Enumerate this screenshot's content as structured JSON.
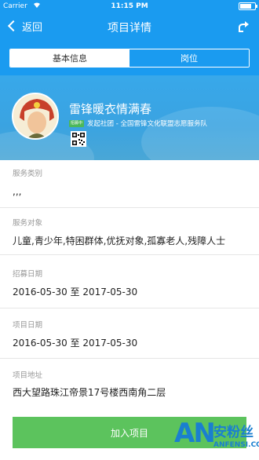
{
  "status_bar": {
    "carrier": "Carrier",
    "time": "11:15 PM"
  },
  "nav": {
    "back_label": "返回",
    "title": "项目详情"
  },
  "tabs": [
    {
      "label": "基本信息",
      "active": true
    },
    {
      "label": "岗位",
      "active": false
    }
  ],
  "project": {
    "name": "雷锋暖衣情满春",
    "status_badge": "招募中",
    "organizer": "发起社团 - 全国雷锋文化联盟志愿服务队"
  },
  "fields": [
    {
      "label": "服务类别",
      "value": ",,,"
    },
    {
      "label": "服务对象",
      "value": "儿童,青少年,特困群体,优抚对象,孤寡老人,残障人士"
    },
    {
      "label": "招募日期",
      "value": "2016-05-30 至 2017-05-30"
    },
    {
      "label": "项目日期",
      "value": "2016-05-30 至 2017-05-30"
    },
    {
      "label": "项目地址",
      "value": "西大望路珠江帝景17号楼西南角二层"
    }
  ],
  "join_button": "加入项目",
  "watermark": {
    "logo": "AN",
    "cn": "安粉丝",
    "en": "ANFENSI.COM"
  },
  "colors": {
    "primary": "#1a9bf0",
    "join": "#5cc35d",
    "badge": "#4cb85a"
  }
}
